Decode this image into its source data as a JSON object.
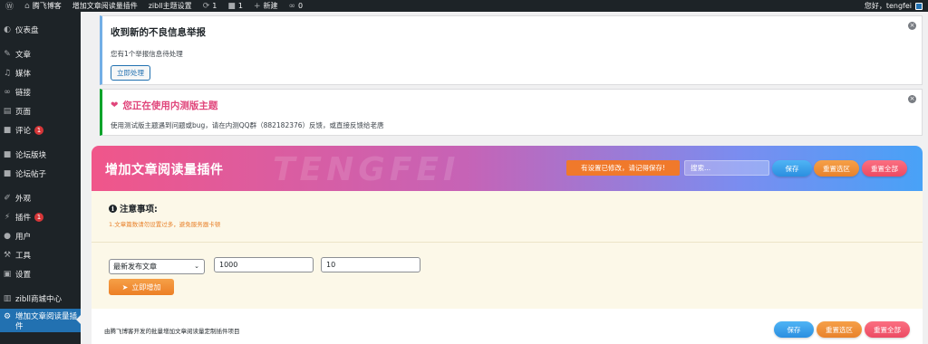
{
  "adminbar": {
    "site_name": "腾飞博客",
    "plugin_link": "增加文章阅读量插件",
    "theme_settings": "zibll主题设置",
    "updates_count": "1",
    "comments_count": "1",
    "new_label": "新建",
    "links_count": "0",
    "greeting": "您好，tengfei"
  },
  "sidebar": {
    "items": [
      {
        "label": "仪表盘",
        "icon": "dashboard-icon"
      },
      {
        "label": "文章",
        "icon": "pin-icon"
      },
      {
        "label": "媒体",
        "icon": "media-icon"
      },
      {
        "label": "链接",
        "icon": "link-icon"
      },
      {
        "label": "页面",
        "icon": "page-icon"
      },
      {
        "label": "评论",
        "icon": "comment-icon",
        "badge": "1"
      },
      {
        "label": "论坛版块",
        "icon": "comment-icon"
      },
      {
        "label": "论坛帖子",
        "icon": "comment-icon"
      },
      {
        "label": "外观",
        "icon": "brush-icon"
      },
      {
        "label": "插件",
        "icon": "plugin-icon",
        "badge": "1"
      },
      {
        "label": "用户",
        "icon": "user-icon"
      },
      {
        "label": "工具",
        "icon": "wrench-icon"
      },
      {
        "label": "设置",
        "icon": "settings-icon"
      },
      {
        "label": "zibll商城中心",
        "icon": "cart-icon"
      },
      {
        "label": "增加文章阅读量插件",
        "icon": "gear-icon"
      }
    ]
  },
  "notices": {
    "report": {
      "title": "收到新的不良信息举报",
      "text": "您有1个举报信息待处理",
      "button": "立即处理"
    },
    "beta": {
      "title": "您正在使用内测版主题",
      "text": "使用测试版主题遇到问题或bug，请在内测QQ群（882182376）反馈，或直接反馈给老唐"
    }
  },
  "panel": {
    "title": "增加文章阅读量插件",
    "watermark": "TENGFEI",
    "unsaved_warning": "有设置已修改，请记得保存!",
    "search_placeholder": "搜索...",
    "save": "保存",
    "reset_section": "重置选区",
    "reset_all": "重置全部",
    "notes_title": "注意事项:",
    "notes_text": "1.文章篇数请勿设置过多，避免服务器卡顿",
    "select_value": "最新发布文章",
    "count_value": "1000",
    "views_value": "10",
    "add_button": "立即增加",
    "footer_text": "由腾飞博客开发的批量增加文章阅读量定制插件项目"
  },
  "colors": {
    "admin_dark": "#1d2327",
    "active_blue": "#2271b1",
    "accent_orange": "#e8822c",
    "beta_pink": "#e0457b"
  }
}
